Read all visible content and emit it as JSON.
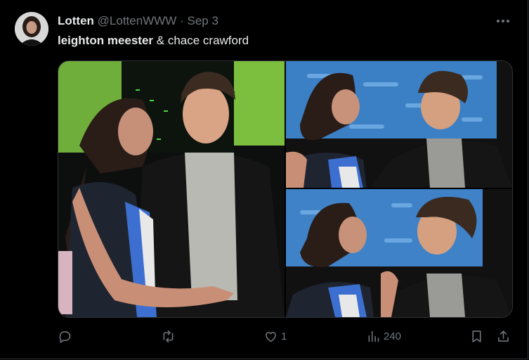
{
  "tweet": {
    "display_name": "Lotten",
    "handle": "@LottenWWW",
    "separator": "·",
    "date": "Sep 3",
    "text_bold": "leighton meester",
    "text_rest": " & chace crawford"
  },
  "actions": {
    "likes": "1",
    "views": "240"
  },
  "colors": {
    "background": "#000000",
    "text": "#e7e9ea",
    "muted": "#71767b",
    "border": "#2f3336"
  },
  "icons": [
    "more-icon",
    "reply-icon",
    "retweet-icon",
    "like-icon",
    "views-icon",
    "bookmark-icon",
    "share-icon"
  ]
}
